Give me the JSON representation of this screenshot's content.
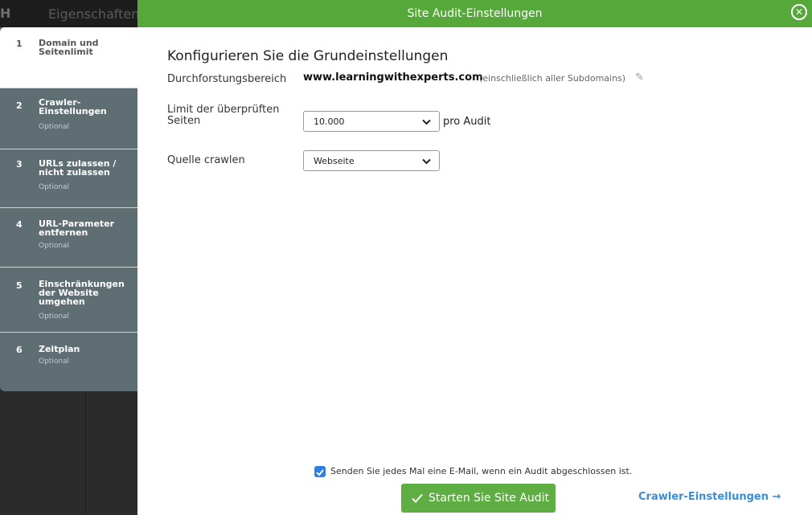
{
  "background": {
    "logo": "H",
    "title": "Eigenschaften"
  },
  "modal": {
    "title": "Site Audit-Einstellungen"
  },
  "steps": [
    {
      "num": "1",
      "label": "Domain und Seitenlimit",
      "optional": ""
    },
    {
      "num": "2",
      "label": "Crawler-Einstellungen",
      "optional": "Optional"
    },
    {
      "num": "3",
      "label": "URLs zulassen / nicht zulassen",
      "optional": "Optional"
    },
    {
      "num": "4",
      "label": "URL-Parameter entfernen",
      "optional": "Optional"
    },
    {
      "num": "5",
      "label": "Einschränkungen der Website umgehen",
      "optional": "Optional"
    },
    {
      "num": "6",
      "label": "Zeitplan",
      "optional": "Optional"
    }
  ],
  "content": {
    "heading": "Konfigurieren Sie die Grundeinstellungen",
    "scope_label": "Durchforstungsbereich",
    "domain": "www.learningwithexperts.com",
    "domain_note": "(einschließlich aller Subdomains)",
    "limit_label": "Limit der überprüften Seiten",
    "limit_value": "10.000",
    "per_audit": "pro Audit",
    "source_label": "Quelle crawlen",
    "source_value": "Webseite"
  },
  "footer": {
    "email_text": "Senden Sie jedes Mal eine E-Mail, wenn ein Audit abgeschlossen ist.",
    "email_checked": true,
    "start_label": "Starten Sie Site Audit",
    "next_label": "Crawler-Einstellungen →"
  },
  "colors": {
    "accent_green": "#56a83a",
    "link_blue": "#3a8ed8",
    "sidebar": "#5e6e73"
  }
}
